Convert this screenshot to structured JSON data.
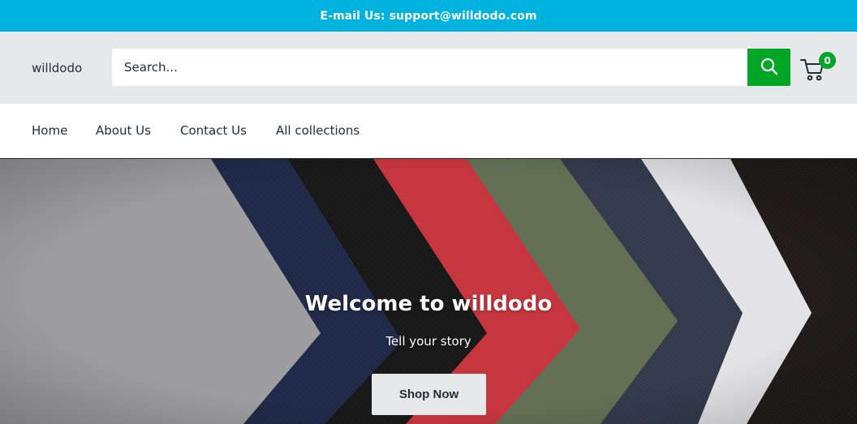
{
  "announcement": {
    "text": "E-mail Us: support@willdodo.com"
  },
  "header": {
    "logo": "willdodo",
    "search": {
      "placeholder": "Search...",
      "value": ""
    },
    "cart": {
      "count": "0"
    }
  },
  "nav": {
    "items": [
      {
        "label": "Home"
      },
      {
        "label": "About Us"
      },
      {
        "label": "Contact Us"
      },
      {
        "label": "All collections"
      }
    ]
  },
  "hero": {
    "title": "Welcome to willdodo",
    "subtitle": "Tell your story",
    "button_label": "Shop Now"
  },
  "colors": {
    "announcement_bg": "#00b3df",
    "header_bg": "#e7e8ea",
    "accent_green": "#00a626",
    "text_dark": "#1e2d3b"
  },
  "icons": {
    "search": "search-icon",
    "cart": "cart-icon"
  }
}
